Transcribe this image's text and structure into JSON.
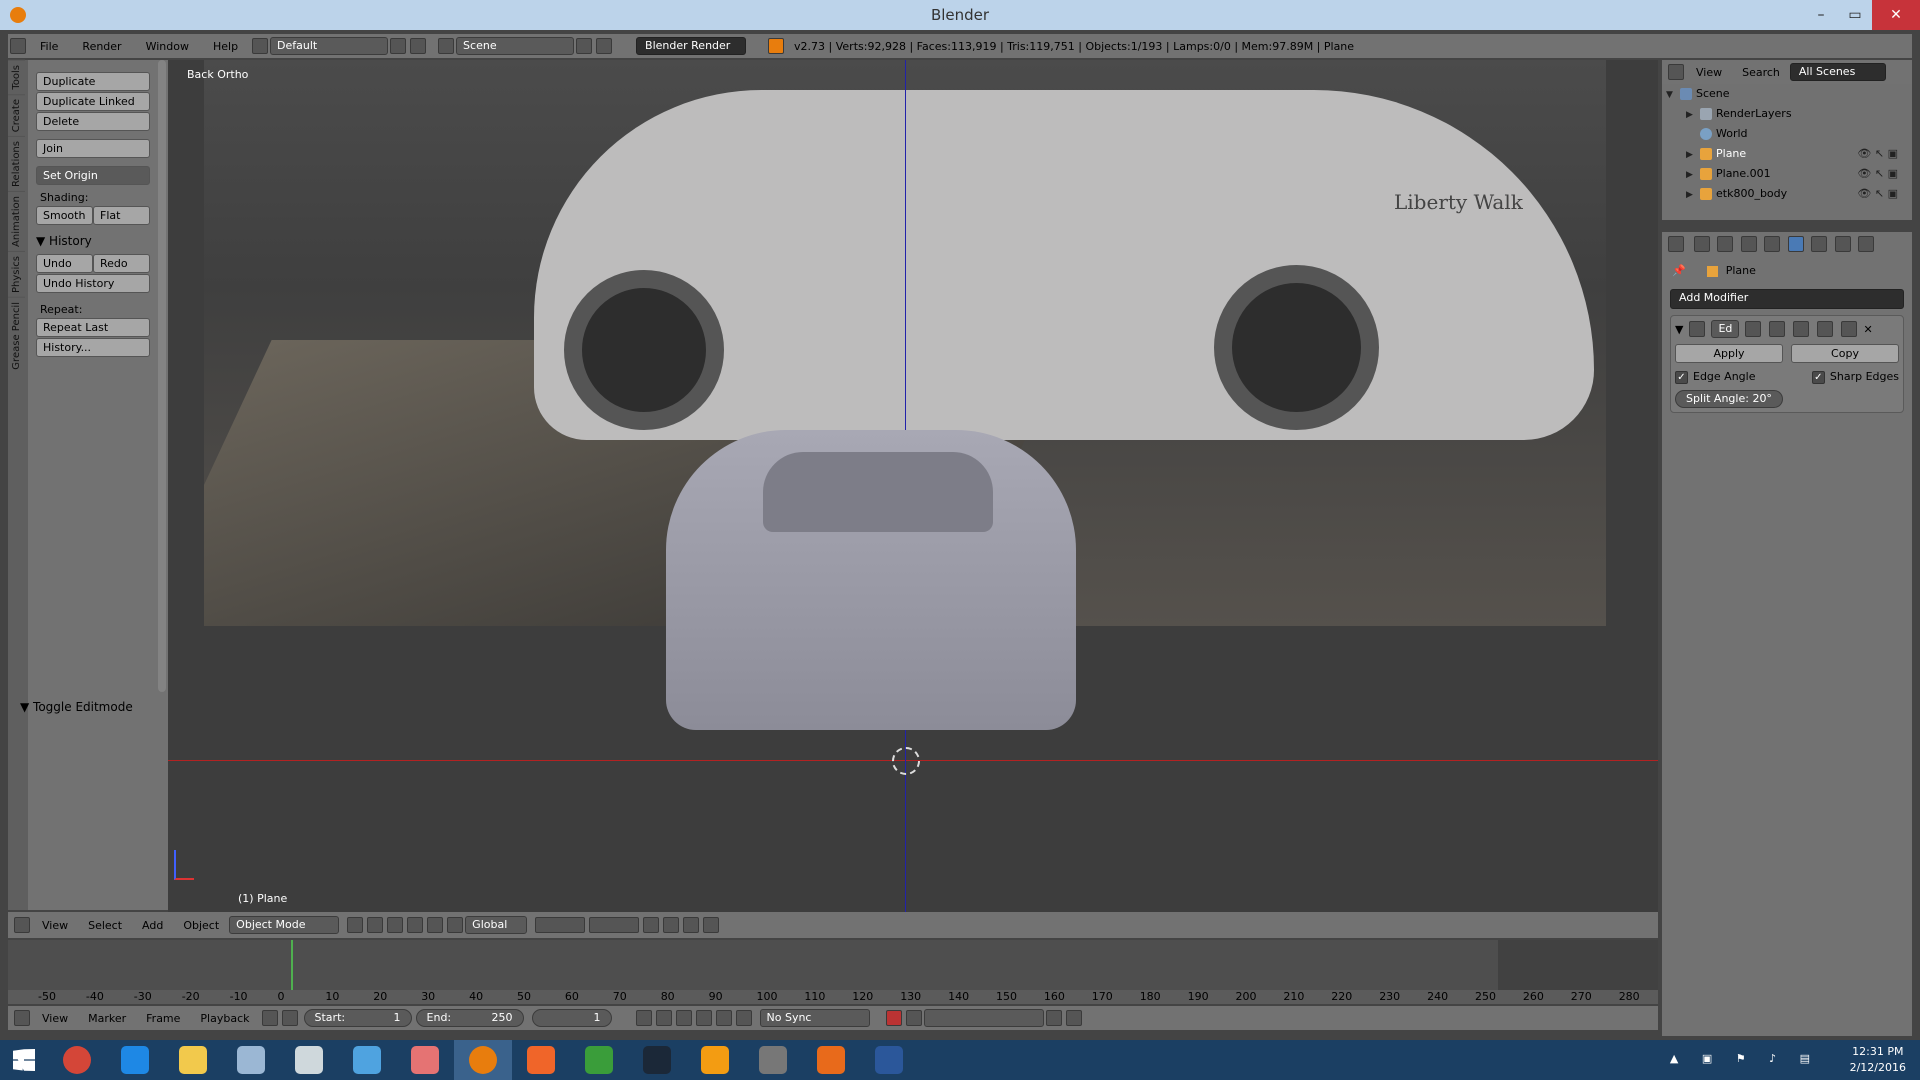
{
  "window": {
    "title": "Blender"
  },
  "info_header": {
    "menus": [
      "File",
      "Render",
      "Window",
      "Help"
    ],
    "layout": "Default",
    "scene": "Scene",
    "engine": "Blender Render",
    "stats": "v2.73 | Verts:92,928 | Faces:113,919 | Tris:119,751 | Objects:1/193 | Lamps:0/0 | Mem:97.89M | Plane"
  },
  "tool_shelf": {
    "tabs": [
      "Tools",
      "Create",
      "Relations",
      "Animation",
      "Physics",
      "Grease Pencil"
    ],
    "duplicate": "Duplicate",
    "duplicate_linked": "Duplicate Linked",
    "delete": "Delete",
    "join": "Join",
    "set_origin": "Set Origin",
    "shading_label": "Shading:",
    "smooth": "Smooth",
    "flat": "Flat",
    "history_panel": "History",
    "undo": "Undo",
    "redo": "Redo",
    "undo_history": "Undo History",
    "repeat_label": "Repeat:",
    "repeat_last": "Repeat Last",
    "history_more": "History...",
    "toggle_editmode": "Toggle Editmode"
  },
  "viewport": {
    "view_label": "Back Ortho",
    "object_label": "(1) Plane",
    "bg_brand": "Liberty Walk"
  },
  "viewport_header": {
    "menus": [
      "View",
      "Select",
      "Add",
      "Object"
    ],
    "mode": "Object Mode",
    "orientation": "Global"
  },
  "timeline": {
    "ruler": [
      "-50",
      "-40",
      "-30",
      "-20",
      "-10",
      "0",
      "10",
      "20",
      "30",
      "40",
      "50",
      "60",
      "70",
      "80",
      "90",
      "100",
      "110",
      "120",
      "130",
      "140",
      "150",
      "160",
      "170",
      "180",
      "190",
      "200",
      "210",
      "220",
      "230",
      "240",
      "250",
      "260",
      "270",
      "280"
    ],
    "menus": [
      "View",
      "Marker",
      "Frame",
      "Playback"
    ],
    "start_label": "Start:",
    "start_value": "1",
    "end_label": "End:",
    "end_value": "250",
    "current_frame": "1",
    "sync": "No Sync"
  },
  "outliner": {
    "menus": [
      "View",
      "Search"
    ],
    "filter": "All Scenes",
    "rows": [
      {
        "label": "Scene"
      },
      {
        "label": "RenderLayers"
      },
      {
        "label": "World"
      },
      {
        "label": "Plane"
      },
      {
        "label": "Plane.001"
      },
      {
        "label": "etk800_body"
      }
    ]
  },
  "properties": {
    "context_object": "Plane",
    "add_modifier": "Add Modifier",
    "modifier_name": "Ed",
    "apply": "Apply",
    "copy": "Copy",
    "edge_angle": "Edge Angle",
    "sharp_edges": "Sharp Edges",
    "split_angle": "Split Angle: 20°"
  },
  "taskbar": {
    "time": "12:31 PM",
    "date": "2/12/2016",
    "apps": [
      "chrome-icon",
      "ie-icon",
      "explorer-icon",
      "notepad-icon",
      "mail-icon",
      "control-panel-icon",
      "paint-icon",
      "blender-icon",
      "app-icon",
      "excel-icon",
      "steam-icon",
      "media-icon",
      "game-icon",
      "app2-icon",
      "word-icon"
    ],
    "app_colors": [
      "#d44638",
      "#1e88e5",
      "#f2c94c",
      "#9bb7d4",
      "#cfd8dc",
      "#4fa3e0",
      "#e57373",
      "#e87d0d",
      "#f06529",
      "#3a9d3a",
      "#1b2838",
      "#f39c12",
      "#777777",
      "#e86a1b",
      "#2b579a"
    ]
  }
}
